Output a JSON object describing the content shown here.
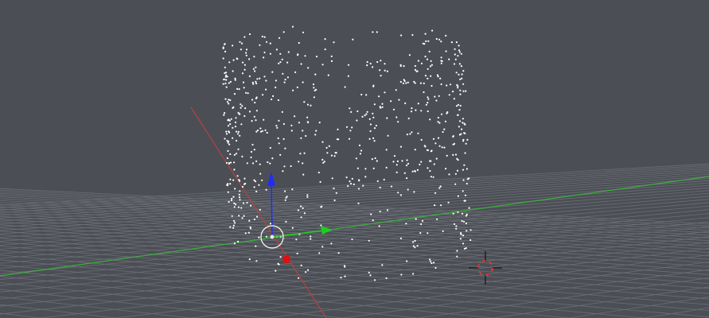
{
  "app": {
    "window_title": "",
    "view": "3D Viewport"
  },
  "colors": {
    "background": "#4b4f55",
    "grid": "#6b6f75",
    "x_axis": "#b5423f",
    "y_axis": "#3fae3f",
    "z_axis": "#1f2cff",
    "gizmo_y_arrow": "#22cc22",
    "gizmo_x_handle": "#dd1111",
    "point": "#ffffff",
    "cursor_ring_red": "#d43a3a",
    "cursor_ring_white": "#ffffff"
  },
  "scene": {
    "objects": [
      {
        "name": "point-cloud-cylinder",
        "type": "point-cloud"
      }
    ],
    "widgets": [
      {
        "name": "transform-gizmo",
        "type": "manipulator",
        "axes": [
          "x",
          "y",
          "z"
        ]
      },
      {
        "name": "3d-cursor",
        "type": "cursor"
      }
    ]
  },
  "icons": {
    "gizmo": "transform-gizmo-icon",
    "cursor": "3d-cursor-icon"
  }
}
